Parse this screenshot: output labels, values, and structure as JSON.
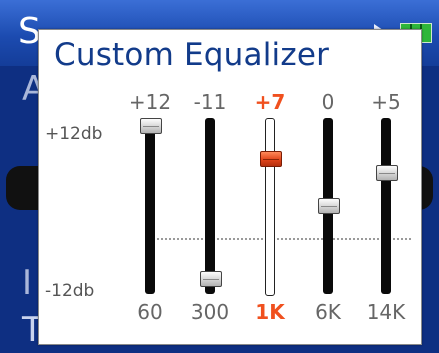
{
  "background": {
    "title_partial": "S",
    "item_a": "A",
    "item_i": "I",
    "item_time": "Time"
  },
  "dialog": {
    "title": "Custom Equalizer"
  },
  "scale": {
    "top": "+12db",
    "bottom": "-12db",
    "min": -12,
    "max": 12
  },
  "bands": [
    {
      "frequency": "60",
      "value_label": "+12",
      "value": 12,
      "selected": false
    },
    {
      "frequency": "300",
      "value_label": "-11",
      "value": -11,
      "selected": false
    },
    {
      "frequency": "1K",
      "value_label": "+7",
      "value": 7,
      "selected": true
    },
    {
      "frequency": "6K",
      "value_label": "0",
      "value": 0,
      "selected": false
    },
    {
      "frequency": "14K",
      "value_label": "+5",
      "value": 5,
      "selected": false
    }
  ],
  "colors": {
    "selected_accent": "#f0501e",
    "title": "#123b8a",
    "background": "#0e2f82"
  }
}
